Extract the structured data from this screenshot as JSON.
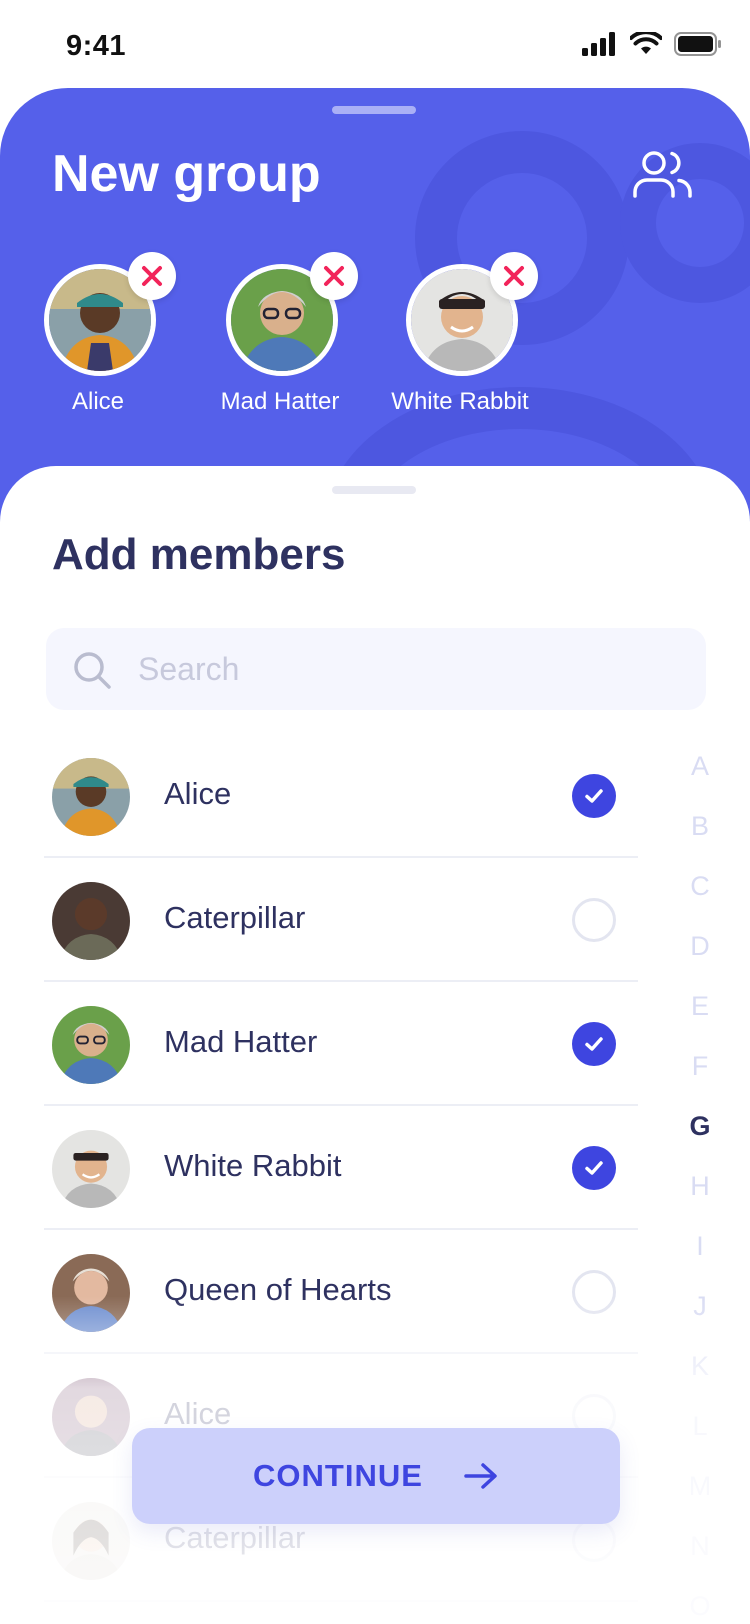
{
  "status_bar": {
    "time": "9:41"
  },
  "header": {
    "title": "New group",
    "selected": [
      {
        "name": "Alice",
        "avatar": "avatar-alice"
      },
      {
        "name": "Mad Hatter",
        "avatar": "avatar-mad-hatter"
      },
      {
        "name": "White Rabbit",
        "avatar": "avatar-white-rabbit"
      }
    ]
  },
  "members": {
    "title": "Add members",
    "search": {
      "placeholder": "Search",
      "value": ""
    },
    "list": [
      {
        "name": "Alice",
        "checked": true
      },
      {
        "name": "Caterpillar",
        "checked": false
      },
      {
        "name": "Mad Hatter",
        "checked": true
      },
      {
        "name": "White Rabbit",
        "checked": true
      },
      {
        "name": "Queen of Hearts",
        "checked": false
      },
      {
        "name": "Alice",
        "checked": false
      },
      {
        "name": "Caterpillar",
        "checked": false
      }
    ],
    "index_letters": [
      "A",
      "B",
      "C",
      "D",
      "E",
      "F",
      "G",
      "H",
      "I",
      "J",
      "K",
      "L",
      "M",
      "N",
      "O"
    ],
    "active_letter": "G",
    "continue_label": "CONTINUE"
  },
  "colors": {
    "accent": "#3e45e0",
    "header_bg": "#5560ea",
    "remove": "#f2245a",
    "text": "#2e3160"
  }
}
